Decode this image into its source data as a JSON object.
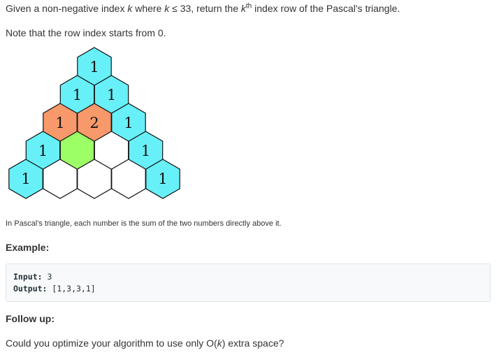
{
  "intro": {
    "part1": "Given a non-negative index ",
    "k1": "k",
    "part2": " where ",
    "k2": "k",
    "part3": " ≤ 33, return the ",
    "k3": "k",
    "sup": "th",
    "part4": " index row of the Pascal's triangle."
  },
  "note": "Note that the row index starts from 0.",
  "figure": {
    "caption": "In Pascal's triangle, each number is the sum of the two numbers directly above it.",
    "colors": {
      "cyan": "#67f0f8",
      "orange": "#f7996a",
      "green": "#9cff66",
      "white": "#ffffff",
      "stroke": "#111111"
    },
    "rows": [
      [
        "1"
      ],
      [
        "1",
        "1"
      ],
      [
        "1",
        "2",
        "1"
      ],
      [
        "1",
        "",
        "",
        "1"
      ],
      [
        "1",
        "",
        "",
        "",
        "1"
      ]
    ],
    "fills": [
      [
        "cyan"
      ],
      [
        "cyan",
        "cyan"
      ],
      [
        "orange",
        "orange",
        "cyan"
      ],
      [
        "cyan",
        "green",
        "white",
        "cyan"
      ],
      [
        "cyan",
        "white",
        "white",
        "white",
        "cyan"
      ]
    ]
  },
  "example": {
    "heading": "Example:",
    "input_label": "Input:",
    "input_value": " 3",
    "output_label": "Output:",
    "output_value": " [1,3,3,1]"
  },
  "follow_up": {
    "heading": "Follow up:",
    "text_before": "Could you optimize your algorithm to use only O(",
    "k": "k",
    "text_after": ") extra space?"
  }
}
